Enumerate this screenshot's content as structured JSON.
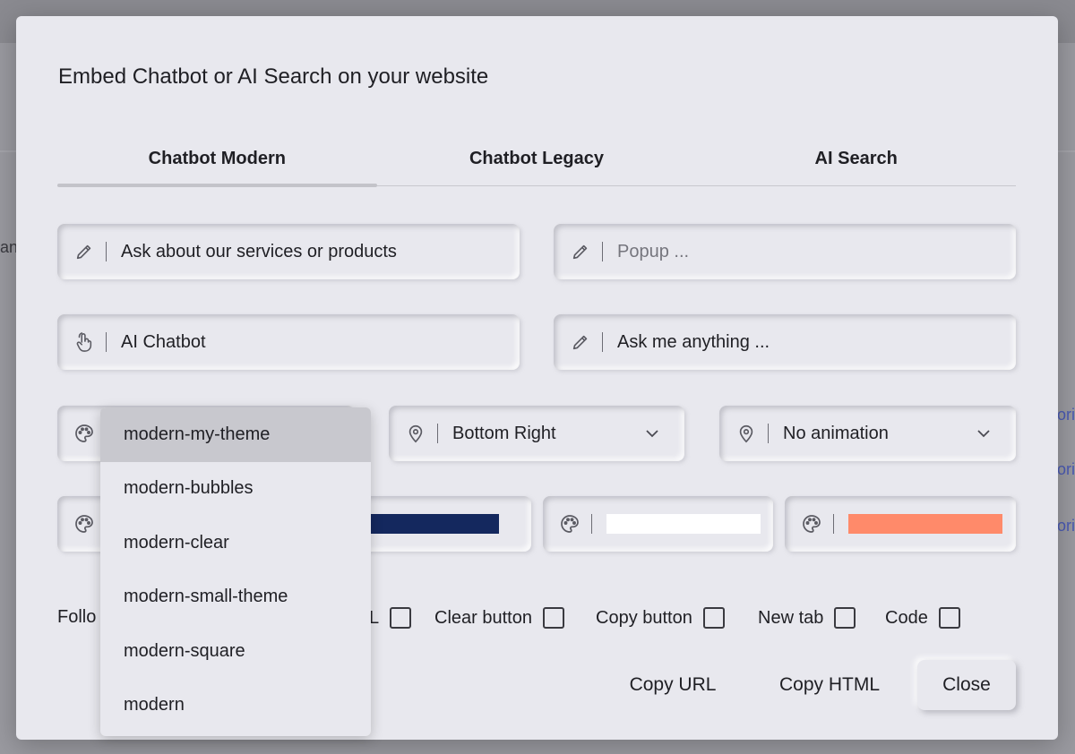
{
  "modal": {
    "title": "Embed Chatbot or AI Search on your website"
  },
  "backdrop": {
    "side_text": "an",
    "right_links": [
      "ori",
      "ori",
      "ori"
    ]
  },
  "tabs": [
    {
      "label": "Chatbot Modern",
      "active": true
    },
    {
      "label": "Chatbot Legacy",
      "active": false
    },
    {
      "label": "AI Search",
      "active": false
    }
  ],
  "fields": {
    "prompt": {
      "value": "Ask about our services or products",
      "icon": "pencil-icon"
    },
    "popup": {
      "placeholder": "Popup  ...",
      "icon": "pencil-icon"
    },
    "chatbot_name": {
      "value": "AI Chatbot",
      "icon": "touch-hand-icon"
    },
    "input_placeholder": {
      "value": "Ask me anything ...",
      "icon": "pencil-icon"
    },
    "theme": {
      "icon": "palette-icon"
    },
    "position": {
      "value": "Bottom Right",
      "icon": "location-pin-icon"
    },
    "animation": {
      "value": "No animation",
      "icon": "location-pin-icon"
    }
  },
  "colors": {
    "primary": "#14285e",
    "secondary": "#ffffff",
    "accent": "#ff8a6a"
  },
  "theme_options": [
    {
      "label": "modern-my-theme",
      "selected": true
    },
    {
      "label": "modern-bubbles",
      "selected": false
    },
    {
      "label": "modern-clear",
      "selected": false
    },
    {
      "label": "modern-small-theme",
      "selected": false
    },
    {
      "label": "modern-square",
      "selected": false
    },
    {
      "label": "modern",
      "selected": false
    }
  ],
  "checkboxes": {
    "follow_partial": "Follo",
    "url_partial": "L",
    "clear_button": "Clear button",
    "copy_button": "Copy button",
    "new_tab": "New tab",
    "code": "Code"
  },
  "actions": {
    "copy_url": "Copy URL",
    "copy_html": "Copy HTML",
    "close": "Close"
  }
}
